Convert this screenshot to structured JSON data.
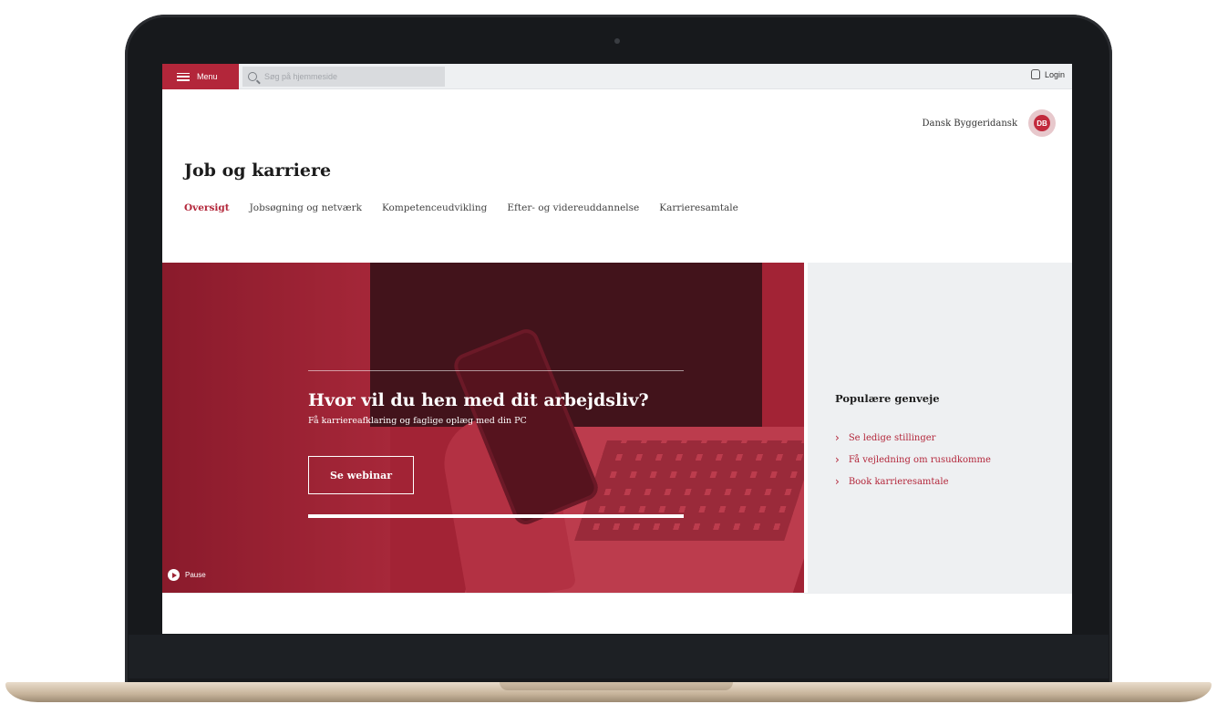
{
  "topbar": {
    "menu_label": "Menu",
    "search_placeholder": "Søg på hjemmeside",
    "login_label": "Login"
  },
  "union": {
    "name": "Dansk Byggeridansk",
    "logo_text": "DB"
  },
  "page": {
    "title": "Job og karriere"
  },
  "tabs": [
    {
      "label": "Oversigt",
      "active": true
    },
    {
      "label": "Jobsøgning og netværk"
    },
    {
      "label": "Kompetenceudvikling"
    },
    {
      "label": "Efter- og videreuddannelse"
    },
    {
      "label": "Karrieresamtale"
    }
  ],
  "hero": {
    "heading": "Hvor vil du hen med dit arbejdsliv?",
    "subtext": "Få karriereafklaring og faglige oplæg med din PC",
    "cta_label": "Se webinar",
    "video_label": "Pause",
    "progress": 1.0
  },
  "shortcuts": {
    "title": "Populære genveje",
    "items": [
      {
        "label": "Se ledige stillinger"
      },
      {
        "label": "Få vejledning om rusudkomme"
      },
      {
        "label": "Book karrieresamtale"
      }
    ]
  },
  "colors": {
    "brand_red": "#b3263a",
    "panel_gray": "#eef0f2"
  },
  "icons": {
    "menu": "hamburger-icon",
    "search": "search-icon",
    "login": "user-icon",
    "video": "play-icon",
    "shortcut": "chevron-right-icon"
  }
}
